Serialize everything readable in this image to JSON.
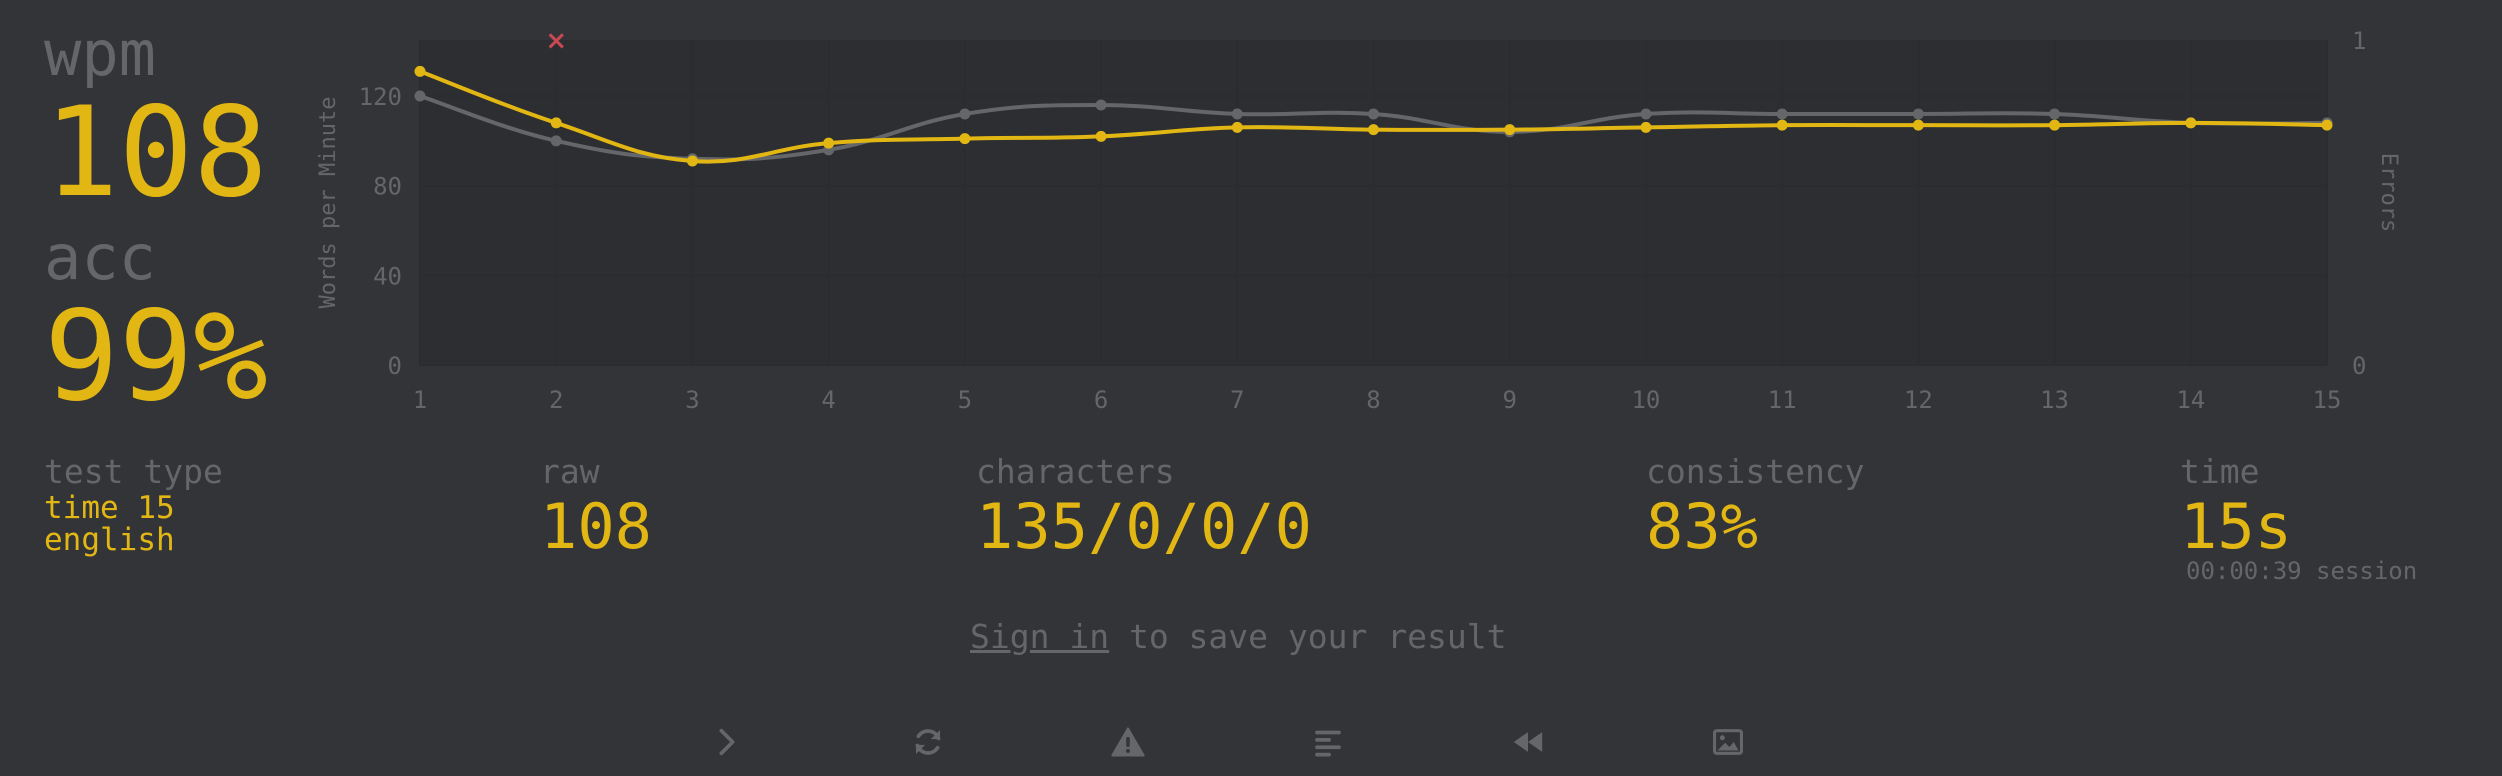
{
  "colors": {
    "background": "#323437",
    "muted": "#646669",
    "accent": "#e2b714",
    "error": "#ca4754",
    "raw_line": "#646669",
    "plot_bg": "#2c2e31"
  },
  "summary": {
    "wpm_label": "wpm",
    "wpm_value": "108",
    "acc_label": "acc",
    "acc_value": "99%"
  },
  "stats": {
    "test_type_label": "test type",
    "test_type_line1": "time 15",
    "test_type_line2": "english",
    "raw_label": "raw",
    "raw_value": "108",
    "characters_label": "characters",
    "characters_value": "135/0/0/0",
    "consistency_label": "consistency",
    "consistency_value": "83%",
    "time_label": "time",
    "time_value": "15s",
    "time_session": "00:00:39 session"
  },
  "signin": {
    "link": "Sign in",
    "rest": " to save your result"
  },
  "buttons": [
    {
      "name": "next-test-button",
      "icon": "chevron-right-icon"
    },
    {
      "name": "restart-test-button",
      "icon": "refresh-icon"
    },
    {
      "name": "report-button",
      "icon": "warning-icon"
    },
    {
      "name": "word-history-button",
      "icon": "align-left-icon"
    },
    {
      "name": "replay-button",
      "icon": "backward-icon"
    },
    {
      "name": "screenshot-button",
      "icon": "image-icon"
    }
  ],
  "chart_data": {
    "type": "line",
    "x": [
      1,
      2,
      3,
      4,
      5,
      6,
      7,
      8,
      9,
      10,
      11,
      12,
      13,
      14,
      15
    ],
    "series": [
      {
        "role": "wpm",
        "values": [
          131,
          108,
          91,
          99,
          101,
          102,
          106,
          105,
          105,
          106,
          107,
          107,
          107,
          108,
          107
        ]
      },
      {
        "role": "raw",
        "values": [
          120,
          100,
          92,
          96,
          112,
          116,
          112,
          112,
          104,
          112,
          112,
          112,
          112,
          108,
          108
        ]
      }
    ],
    "errors": [
      {
        "x": 2,
        "count": 1
      }
    ],
    "ylabel": "Words per Minute",
    "y2label": "Errors",
    "ylim": [
      0,
      145
    ],
    "yticks": [
      "0",
      "40",
      "80",
      "120"
    ],
    "y2ticks": [
      "0",
      "1"
    ],
    "error_marker": "×",
    "grid": true
  }
}
